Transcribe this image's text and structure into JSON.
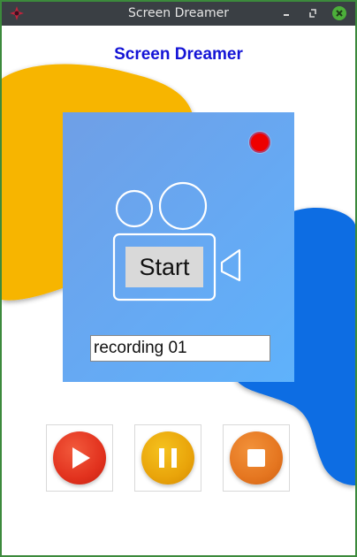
{
  "window": {
    "title": "Screen Dreamer",
    "icons": {
      "app": "app-icon",
      "minimize": "minimize-icon",
      "maximize": "maximize-icon",
      "close": "close-icon"
    }
  },
  "header": {
    "title": "Screen Dreamer"
  },
  "recorder": {
    "start_label": "Start",
    "filename_value": "recording 01",
    "status_indicator": "recording-dot-icon",
    "camera_icon": "video-camera-icon"
  },
  "controls": [
    {
      "name": "play",
      "icon": "play-icon"
    },
    {
      "name": "pause",
      "icon": "pause-icon"
    },
    {
      "name": "stop",
      "icon": "stop-icon"
    }
  ],
  "colors": {
    "heading": "#1414d6",
    "panel": "#66a9f3",
    "record_dot": "#ee0000",
    "blob_yellow": "#f7b500",
    "blob_blue": "#0a6de3",
    "play": "#e2321e",
    "pause": "#e9a40a",
    "stop": "#e57620",
    "window_border": "#3c8a3c"
  }
}
